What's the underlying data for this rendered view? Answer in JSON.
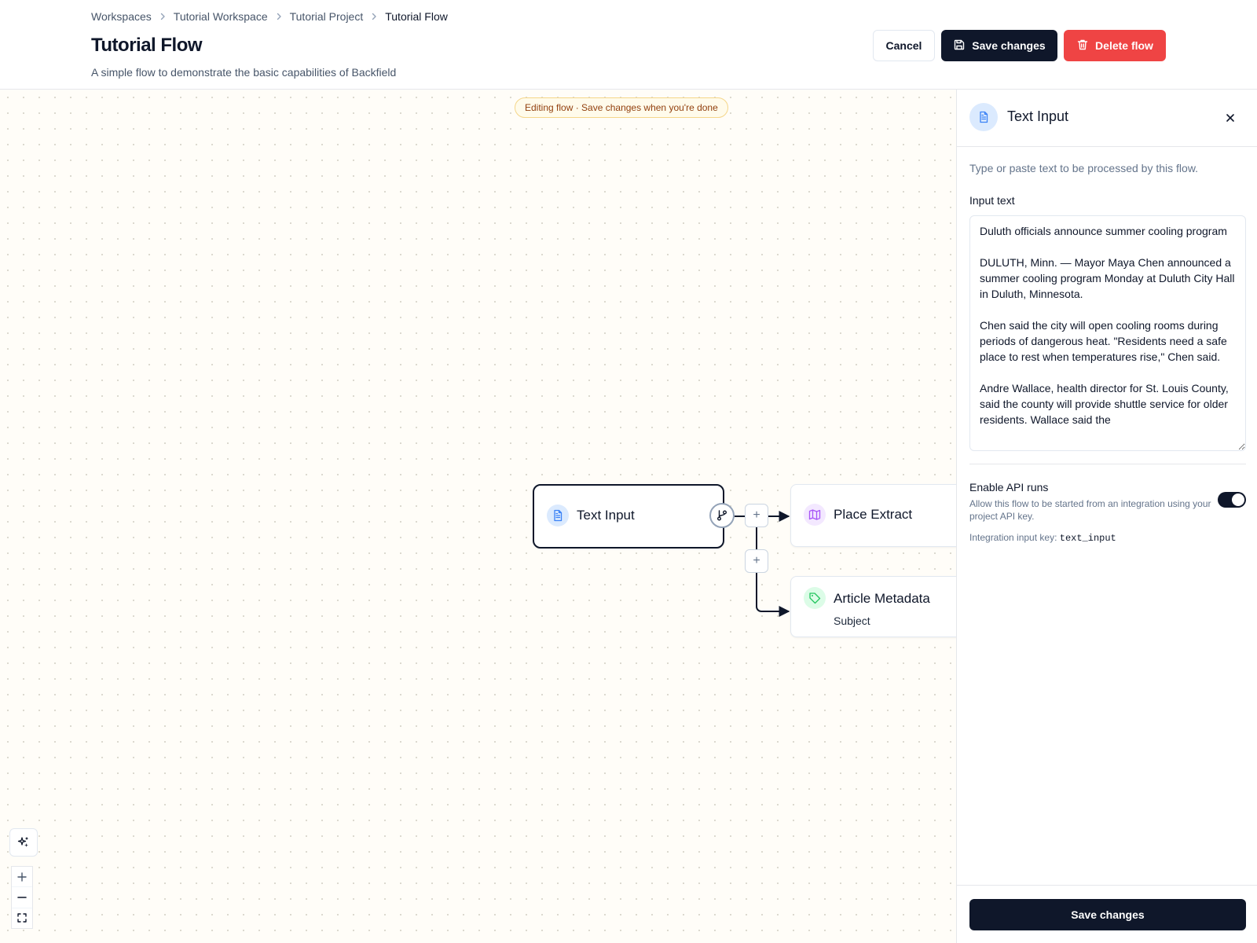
{
  "breadcrumb": [
    "Workspaces",
    "Tutorial Workspace",
    "Tutorial Project",
    "Tutorial Flow"
  ],
  "header": {
    "title": "Tutorial Flow",
    "subtitle": "A simple flow to demonstrate the basic capabilities of Backfield",
    "cancel_label": "Cancel",
    "save_label": "Save changes",
    "delete_label": "Delete flow"
  },
  "canvas": {
    "banner": "Editing flow · Save changes when you're done",
    "nodes": {
      "text_input": {
        "title": "Text Input",
        "icon": "document-icon"
      },
      "place_extract": {
        "title": "Place Extract",
        "icon": "map-icon"
      },
      "article_metadata": {
        "title": "Article Metadata",
        "subtitle": "Subject",
        "icon": "tag-icon"
      }
    },
    "add_symbol": "+"
  },
  "panel": {
    "title": "Text Input",
    "description": "Type or paste text to be processed by this flow.",
    "input_label": "Input text",
    "input_value": "Duluth officials announce summer cooling program\n\nDULUTH, Minn. — Mayor Maya Chen announced a summer cooling program Monday at Duluth City Hall in Duluth, Minnesota.\n\nChen said the city will open cooling rooms during periods of dangerous heat. \"Residents need a safe place to rest when temperatures rise,\" Chen said.\n\nAndre Wallace, health director for St. Louis County, said the county will provide shuttle service for older residents. Wallace said the",
    "api_label": "Enable API runs",
    "api_description": "Allow this flow to be started from an integration using your project API key.",
    "api_enabled": true,
    "api_key_label": "Integration input key:",
    "api_key_value": "text_input",
    "save_label": "Save changes"
  },
  "colors": {
    "primary": "#0f172a",
    "danger": "#ef4444",
    "banner_text": "#92400e"
  }
}
